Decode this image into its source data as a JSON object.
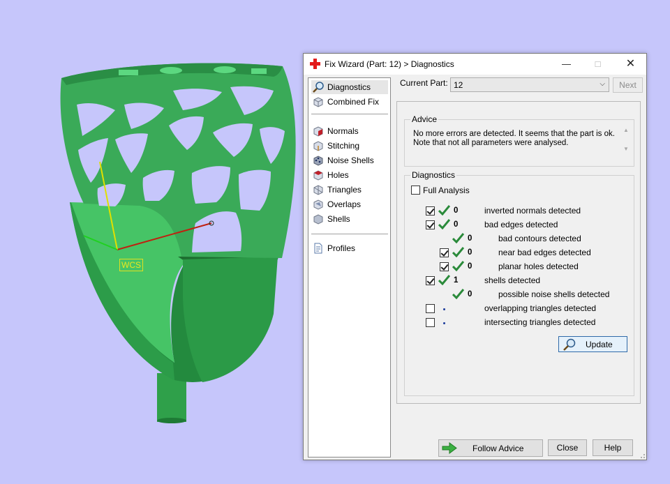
{
  "viewport": {
    "wcs_label": "WCS",
    "colors": {
      "background": "#c6c6fb",
      "model": "#3faa58",
      "axis_x": "#c02010",
      "axis_y": "#e0e000",
      "axis_z": "#20d020"
    }
  },
  "dialog": {
    "title": "Fix Wizard (Part: 12) > Diagnostics",
    "nav": {
      "items": [
        {
          "label": "Diagnostics",
          "icon": "magnifier-icon"
        },
        {
          "label": "Combined Fix",
          "icon": "cube-icon"
        },
        {
          "label": "Normals",
          "icon": "normals-cube-icon"
        },
        {
          "label": "Stitching",
          "icon": "stitching-cube-icon"
        },
        {
          "label": "Noise Shells",
          "icon": "noise-shells-icon"
        },
        {
          "label": "Holes",
          "icon": "holes-cube-icon"
        },
        {
          "label": "Triangles",
          "icon": "triangles-cube-icon"
        },
        {
          "label": "Overlaps",
          "icon": "overlaps-cube-icon"
        },
        {
          "label": "Shells",
          "icon": "shells-cube-icon"
        },
        {
          "label": "Profiles",
          "icon": "document-icon"
        }
      ]
    },
    "current_part_label": "Current Part:",
    "current_part_value": "12",
    "next_label": "Next",
    "advice": {
      "title": "Advice",
      "text_line1": "No more errors are detected. It seems that the part is ok.",
      "text_line2": "Note that not all parameters were analysed."
    },
    "diagnostics": {
      "title": "Diagnostics",
      "full_analysis_label": "Full Analysis",
      "rows": [
        {
          "label": "inverted normals detected",
          "count": "0",
          "checked": true
        },
        {
          "label": "bad edges detected",
          "count": "0",
          "checked": true
        },
        {
          "label": "bad contours detected",
          "count": "0"
        },
        {
          "label": "near bad edges detected",
          "count": "0",
          "checked": true
        },
        {
          "label": "planar holes detected",
          "count": "0",
          "checked": true
        },
        {
          "label": "shells detected",
          "count": "1",
          "checked": true
        },
        {
          "label": "possible noise shells detected",
          "count": "0"
        },
        {
          "label": "overlapping triangles detected",
          "checked": false
        },
        {
          "label": "intersecting triangles detected",
          "checked": false
        }
      ]
    },
    "update_label": "Update",
    "follow_advice_label": "Follow Advice",
    "close_label": "Close",
    "help_label": "Help"
  }
}
